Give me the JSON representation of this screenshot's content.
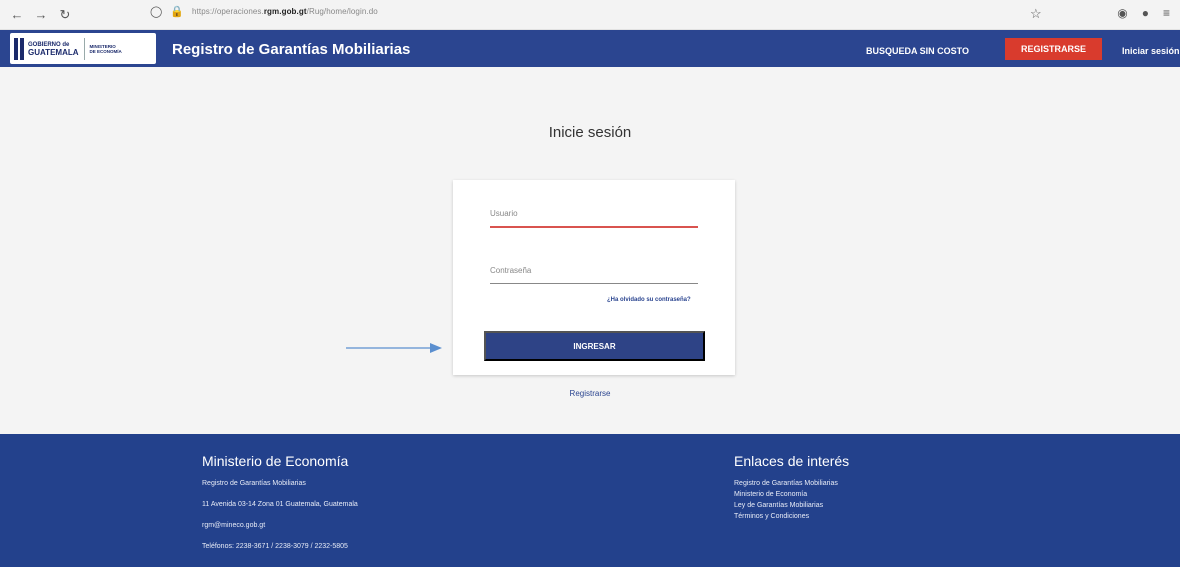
{
  "browser": {
    "url_prefix": "https://operaciones.",
    "url_domain": "rgm.gob.gt",
    "url_path": "/Rug/home/login.do"
  },
  "header": {
    "logo_gov_line1": "GOBIERNO de",
    "logo_gov_line2": "GUATEMALA",
    "logo_ministry_line1": "MINISTERIO",
    "logo_ministry_line2": "DE ECONOMÍA",
    "title": "Registro de Garantías Mobiliarias",
    "nav_free_search": "BUSQUEDA SIN COSTO",
    "nav_register": "REGISTRARSE",
    "nav_login": "Iniciar sesión"
  },
  "login": {
    "title": "Inicie sesión",
    "username_label": "Usuario",
    "password_label": "Contraseña",
    "forgot_link": "¿Ha olvidado su contraseña?",
    "submit_label": "INGRESAR",
    "register_link": "Registrarse"
  },
  "footer": {
    "left": {
      "heading": "Ministerio de Economía",
      "lines": [
        "Registro de Garantías Mobiliarias",
        "11 Avenida 03-14 Zona 01 Guatemala, Guatemala",
        "rgm@mineco.gob.gt",
        "Teléfonos: 2238-3671 / 2238-3079 / 2232-5805"
      ]
    },
    "right": {
      "heading": "Enlaces de interés",
      "links": [
        "Registro de Garantías Mobiliarias",
        "Ministerio de Economía",
        "Ley de Garantías Mobiliarias",
        "Términos y Condiciones"
      ]
    }
  },
  "colors": {
    "header_bg": "#2b4590",
    "register_button": "#d93b2d",
    "submit_button": "#2e4386",
    "footer_bg": "#23418c",
    "arrow": "#5b8fcf"
  }
}
